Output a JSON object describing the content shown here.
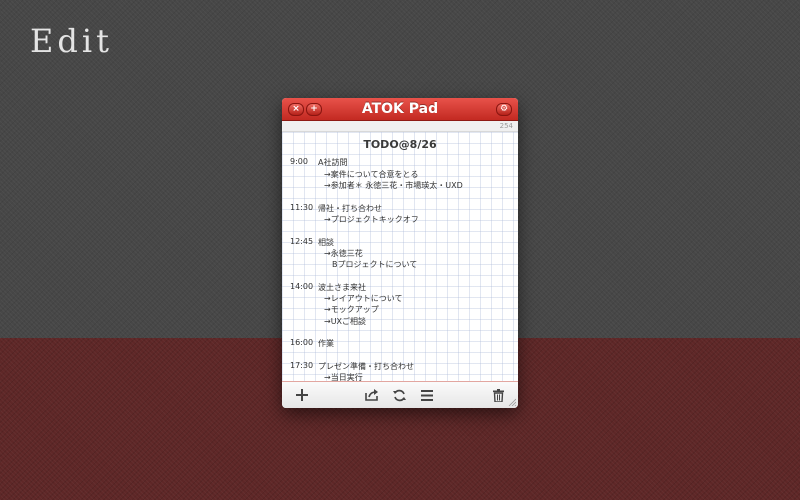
{
  "screen_heading": "Edit",
  "window": {
    "title": "ATOK Pad",
    "char_count": "254",
    "buttons": {
      "close": "×",
      "add": "+",
      "settings": "⚙"
    }
  },
  "document": {
    "title": "TODO@8/26",
    "lines": [
      {
        "time": "9:00",
        "text": "A社訪問"
      },
      {
        "time": "",
        "text": "→案件について合意をとる"
      },
      {
        "time": "",
        "text": "→参加者＊ 永徳三花・市場瑛太・UXD"
      },
      {
        "time": "11:30",
        "text": "帰社・打ち合わせ"
      },
      {
        "time": "",
        "text": "→プロジェクトキックオフ"
      },
      {
        "time": "12:45",
        "text": "相談"
      },
      {
        "time": "",
        "text": "→永徳三花"
      },
      {
        "time": "",
        "text": "Bプロジェクトについて"
      },
      {
        "time": "14:00",
        "text": "波土さま来社"
      },
      {
        "time": "",
        "text": "→レイアウトについて"
      },
      {
        "time": "",
        "text": "→モックアップ"
      },
      {
        "time": "",
        "text": "→UXご相談"
      },
      {
        "time": "16:00",
        "text": "作業"
      },
      {
        "time": "17:30",
        "text": "プレゼン準備・打ち合わせ"
      },
      {
        "time": "",
        "text": "→当日実行"
      }
    ]
  },
  "colors": {
    "titlebar": "#d63b33",
    "background_top": "#474747",
    "background_bottom": "#5e2727"
  },
  "toolbar": {
    "icons": [
      "add-icon",
      "share-icon",
      "sync-icon",
      "list-icon",
      "trash-icon"
    ]
  }
}
